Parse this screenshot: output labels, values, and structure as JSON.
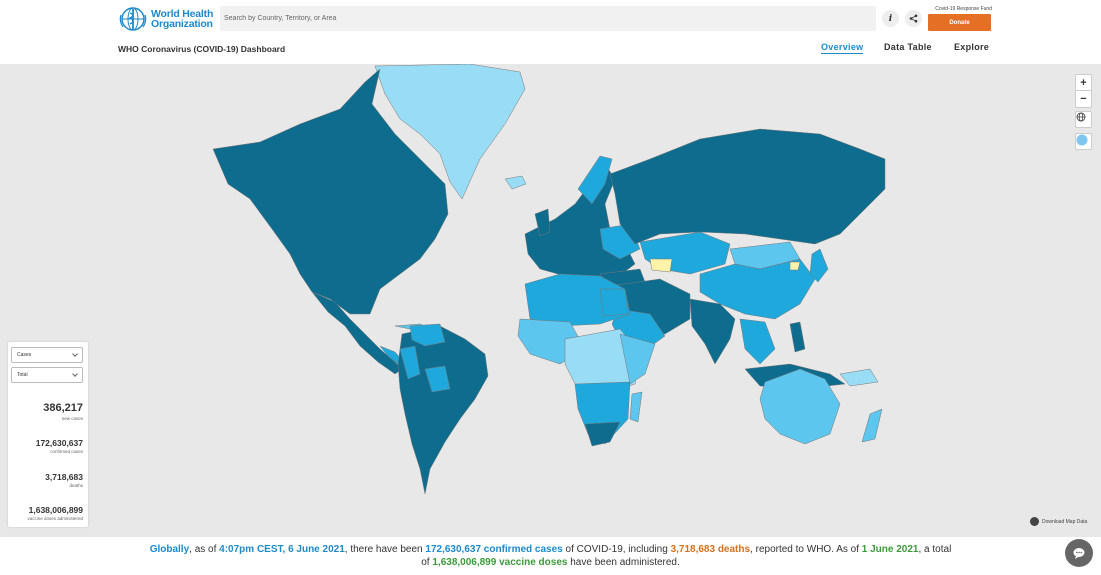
{
  "header": {
    "logo_line1": "World Health",
    "logo_line2": "Organization",
    "search_placeholder": "Search by Country, Territory, or Area",
    "info_label": "i",
    "fund_label": "Covid-19 Response Fund",
    "donate_label": "Donate"
  },
  "subheader": {
    "title": "WHO Coronavirus (COVID-19) Dashboard",
    "nav": [
      "Overview",
      "Data Table",
      "Explore"
    ],
    "active": "Overview"
  },
  "map": {
    "zoom_in": "+",
    "zoom_out": "−",
    "download_label": "Download Map Data",
    "colors": {
      "ocean": "#e8e8e8",
      "dark": "#0e6d8f",
      "medium": "#1fa8dc",
      "light": "#5cc6ee",
      "pale": "#99dcf5",
      "yellow": "#fef3a8",
      "grey": "#bdbdbd"
    }
  },
  "stats": {
    "metric_select": "Cases",
    "period_select": "Total",
    "items": [
      {
        "value": "386,217",
        "label": "new cases"
      },
      {
        "value": "172,630,637",
        "label": "confirmed cases"
      },
      {
        "value": "3,718,683",
        "label": "deaths"
      },
      {
        "value": "1,638,006,899",
        "label": "vaccine doses administered"
      }
    ]
  },
  "footer": {
    "globally": "Globally",
    "t1": ", as of ",
    "time": "4:07pm CEST, 6 June 2021",
    "t2": ", there have been ",
    "cases": "172,630,637 confirmed cases",
    "t3": " of COVID-19, including ",
    "deaths": "3,718,683 deaths",
    "t4": ", reported to WHO. As of ",
    "vax_date": "1 June 2021",
    "t5": ", a total",
    "t6": "of ",
    "doses": "1,638,006,899 vaccine doses",
    "t7": " have been administered."
  }
}
